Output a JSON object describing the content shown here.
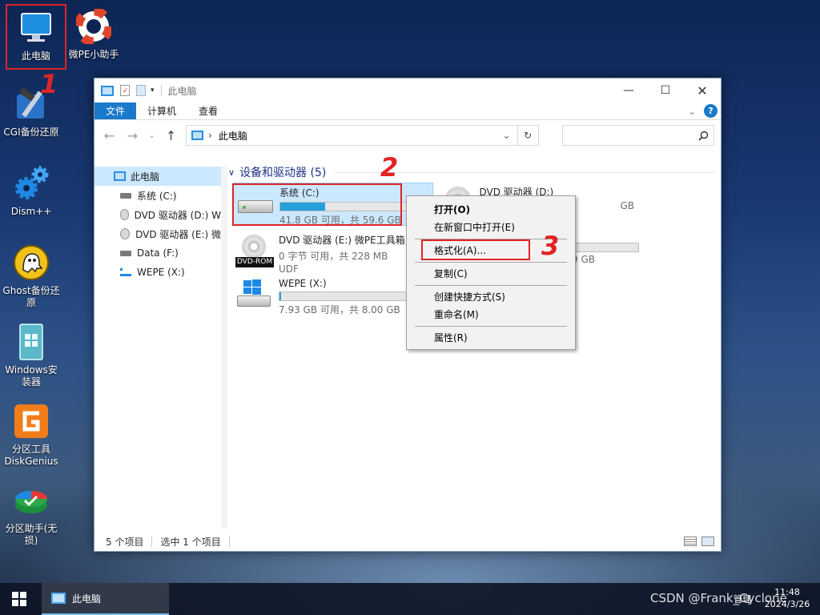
{
  "desktop": {
    "icons": [
      {
        "label": "此电脑",
        "icon": "computer-icon"
      },
      {
        "label": "微PE小助手",
        "icon": "lifebuoy-icon"
      },
      {
        "label": "CGI备份还原",
        "icon": "hammer-icon"
      },
      {
        "label": "Dism++",
        "icon": "gears-icon"
      },
      {
        "label": "Ghost备份还原",
        "icon": "ghost-icon"
      },
      {
        "label": "Windows安装器",
        "icon": "windows-installer-icon"
      },
      {
        "label": "分区工具DiskGenius",
        "icon": "diskgenius-icon"
      },
      {
        "label": "分区助手(无损)",
        "icon": "partition-assistant-icon"
      }
    ]
  },
  "annotations": {
    "m1": "1",
    "m2": "2",
    "m3": "3"
  },
  "window": {
    "title": "此电脑",
    "tabs": {
      "file": "文件",
      "computer": "计算机",
      "view": "查看"
    },
    "help": "?",
    "address": "此电脑",
    "sidebar": [
      {
        "label": "此电脑",
        "icon": "computer-icon"
      },
      {
        "label": "系统 (C:)",
        "icon": "drive-icon"
      },
      {
        "label": "DVD 驱动器 (D:) W",
        "icon": "dvd-icon"
      },
      {
        "label": "DVD 驱动器 (E:) 微",
        "icon": "dvd-icon"
      },
      {
        "label": "Data (F:)",
        "icon": "drive-icon"
      },
      {
        "label": "WEPE (X:)",
        "icon": "network-drive-icon"
      }
    ],
    "group_title": "设备和驱动器 (5)",
    "drives": {
      "c": {
        "name": "系统 (C:)",
        "sub": "41.8 GB 可用，共 59.6 GB",
        "used_fraction": 0.3
      },
      "e": {
        "name": "DVD 驱动器 (E:) 微PE工具箱",
        "sub1": "0 字节 可用，共 228 MB",
        "sub2": "UDF",
        "badge": "DVD-ROM"
      },
      "x": {
        "name": "WEPE (X:)",
        "sub": "7.93 GB 可用，共 8.00 GB",
        "used_fraction": 0.01
      },
      "d": {
        "name": "DVD 驱动器 (D:)",
        "sub": "GB"
      },
      "f": {
        "sub": "9 GB"
      }
    },
    "status": {
      "count": "5 个项目",
      "selected": "选中 1 个项目"
    }
  },
  "context_menu": {
    "open": "打开(O)",
    "open_new": "在新窗口中打开(E)",
    "format": "格式化(A)...",
    "copy": "复制(C)",
    "shortcut": "创建快捷方式(S)",
    "rename": "重命名(M)",
    "properties": "属性(R)"
  },
  "taskbar": {
    "task": "此电脑",
    "time": "11:48",
    "date": "2024/3/26",
    "tray": "管理"
  },
  "watermark": "CSDN @Frank_Cyclone"
}
